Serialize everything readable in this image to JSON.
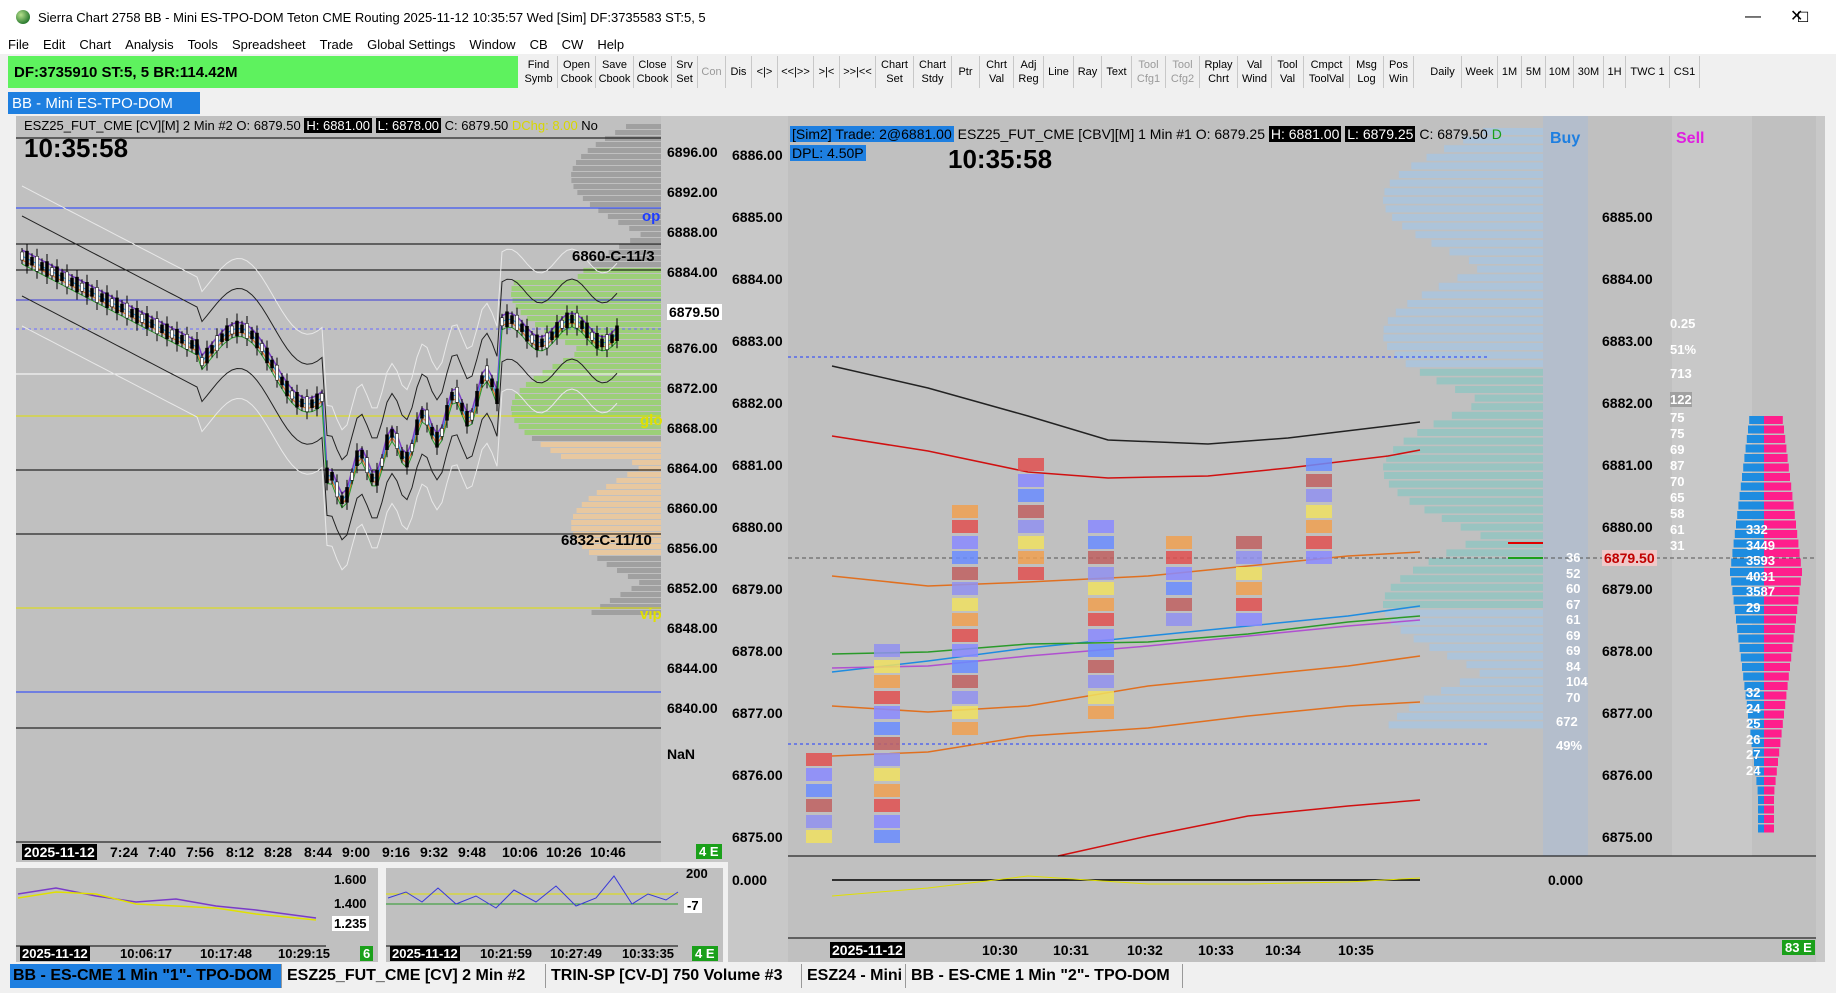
{
  "window": {
    "title": "Sierra Chart 2758 BB - Mini ES-TPO-DOM Teton CME Routing 2025-11-12  10:35:57 Wed [Sim] DF:3735583  ST:5, 5",
    "minimize": "—",
    "maximize": "☐",
    "close": "✕"
  },
  "menu": [
    "File",
    "Edit",
    "Chart",
    "Analysis",
    "Tools",
    "Spreadsheet",
    "Trade",
    "Global Settings",
    "Window",
    "CB",
    "CW",
    "Help"
  ],
  "status_bar": {
    "text": "DF:3735910  ST:5, 5   BR:114.42M",
    "color": "#5ef25e"
  },
  "toolbar": [
    {
      "label": "Find\nSymb",
      "disabled": false
    },
    {
      "label": "Open\nCbook",
      "disabled": false
    },
    {
      "label": "Save\nCbook",
      "disabled": false
    },
    {
      "label": "Close\nCbook",
      "disabled": false
    },
    {
      "label": "Srv\nSet",
      "disabled": false
    },
    {
      "label": "Con",
      "disabled": true
    },
    {
      "label": "Dis",
      "disabled": false
    },
    {
      "label": "<|>",
      "disabled": false
    },
    {
      "label": "<<|>>",
      "disabled": false
    },
    {
      "label": ">|<",
      "disabled": false
    },
    {
      "label": ">>|<<",
      "disabled": false
    },
    {
      "label": "Chart\nSet",
      "disabled": false
    },
    {
      "label": "Chart\nStdy",
      "disabled": false
    },
    {
      "label": "Ptr",
      "disabled": false
    },
    {
      "label": "Chrt\nVal",
      "disabled": false
    },
    {
      "label": "Adj\nReg",
      "disabled": false
    },
    {
      "label": "Line",
      "disabled": false
    },
    {
      "label": "Ray",
      "disabled": false
    },
    {
      "label": "Text",
      "disabled": false
    },
    {
      "label": "Tool\nCfg1",
      "disabled": true
    },
    {
      "label": "Tool\nCfg2",
      "disabled": true
    },
    {
      "label": "Rplay\nChrt",
      "disabled": false
    },
    {
      "label": "Val\nWind",
      "disabled": false
    },
    {
      "label": "Tool\nVal",
      "disabled": false
    },
    {
      "label": "Cmpct\nToolVal",
      "disabled": false
    },
    {
      "label": "Msg\nLog",
      "disabled": false
    },
    {
      "label": "Pos\nWin",
      "disabled": false
    },
    {
      "label": "Daily",
      "disabled": false
    },
    {
      "label": "Week",
      "disabled": false
    },
    {
      "label": "1M",
      "disabled": false
    },
    {
      "label": "5M",
      "disabled": false
    },
    {
      "label": "10M",
      "disabled": false
    },
    {
      "label": "30M",
      "disabled": false
    },
    {
      "label": "1H",
      "disabled": false
    },
    {
      "label": "TWC 1",
      "disabled": false
    },
    {
      "label": "CS1",
      "disabled": false
    }
  ],
  "chartbook_title": "BB - Mini ES-TPO-DOM",
  "left_chart": {
    "header_symbol": "ESZ25_FUT_CME [CV][M]  2 Min  #2 O: 6879.50",
    "high": "H: 6881.00",
    "low": "L: 6878.00",
    "close": "C: 6879.50",
    "dchg": "DChg: 8.00",
    "no": "No",
    "clock": "10:35:58",
    "price_labels": [
      "6896.00",
      "6892.00",
      "6888.00",
      "6884.00",
      "6879.50",
      "6876.00",
      "6872.00",
      "6868.00",
      "6864.00",
      "6860.00",
      "6856.00",
      "6852.00",
      "6848.00",
      "6844.00",
      "6840.00",
      "NaN"
    ],
    "annotations": [
      "6860-C-11/3",
      "6832-C-11/10",
      "op",
      "glo",
      "vip"
    ],
    "time_labels": [
      "2025-11-12",
      "7:24",
      "7:40",
      "7:56",
      "8:12",
      "8:28",
      "8:44",
      "9:00",
      "9:16",
      "9:32",
      "9:48",
      "10:06",
      "10:26",
      "10:46"
    ],
    "badge": "4 E"
  },
  "sub_chart_1": {
    "price_labels": [
      "1.600",
      "1.400",
      "1.235"
    ],
    "time_labels": [
      "2025-11-12",
      "10:06:17",
      "10:17:48",
      "10:29:15"
    ],
    "badge": "6"
  },
  "sub_chart_2": {
    "price_labels": [
      "200",
      "-7"
    ],
    "time_labels": [
      "2025-11-12",
      "10:21:59",
      "10:27:49",
      "10:33:35"
    ],
    "badge": "4 E"
  },
  "right_chart": {
    "sim": "[Sim2]  Trade: 2@6881.00",
    "dpl": "DPL: 4.50P",
    "header_symbol": "ESZ25_FUT_CME [CBV][M]  1 Min  #1 O: 6879.25",
    "high": "H: 6881.00",
    "low": "L: 6879.25",
    "close": "C: 6879.50",
    "d": "D",
    "clock": "10:35:58",
    "buy_label": "Buy",
    "sell_label": "Sell",
    "price_labels_left": [
      "6886.00",
      "6885.00",
      "6884.00",
      "6883.00",
      "6882.00",
      "6881.00",
      "6880.00",
      "6879.00",
      "6878.00",
      "6877.00",
      "6876.00",
      "6875.00",
      "0.000"
    ],
    "price_labels_right": [
      "6885.00",
      "6884.00",
      "6883.00",
      "6882.00",
      "6881.00",
      "6880.00",
      "6879.50",
      "6879.00",
      "6878.00",
      "6877.00",
      "6876.00",
      "6875.00",
      "0.000"
    ],
    "time_labels": [
      "2025-11-12",
      "10:30",
      "10:31",
      "10:32",
      "10:33",
      "10:34",
      "10:35"
    ],
    "stats": [
      "0.25",
      "51%",
      "713",
      "122",
      "75",
      "75",
      "69",
      "87",
      "70",
      "65",
      "58",
      "61",
      "31"
    ],
    "buy_stats": [
      "36",
      "52",
      "60",
      "67",
      "61",
      "69",
      "69",
      "84",
      "104",
      "70",
      "672",
      "49%"
    ],
    "sell_stats": [
      "332",
      "3449",
      "3593",
      "4031",
      "3587",
      "29",
      "32",
      "24",
      "25",
      "26",
      "27",
      "24"
    ],
    "badge": "83 E"
  },
  "footprint": [
    {
      "x": 6879.5,
      "label": "tbl"
    }
  ],
  "tabs": [
    "BB - ES-CME 1 Min \"1\"- TPO-DOM",
    "ESZ25_FUT_CME [CV]  2 Min  #2",
    "TRIN-SP [CV-D]  750 Volume #3",
    "ESZ24 - Mini",
    "BB - ES-CME 1 Min \"2\"- TPO-DOM"
  ]
}
